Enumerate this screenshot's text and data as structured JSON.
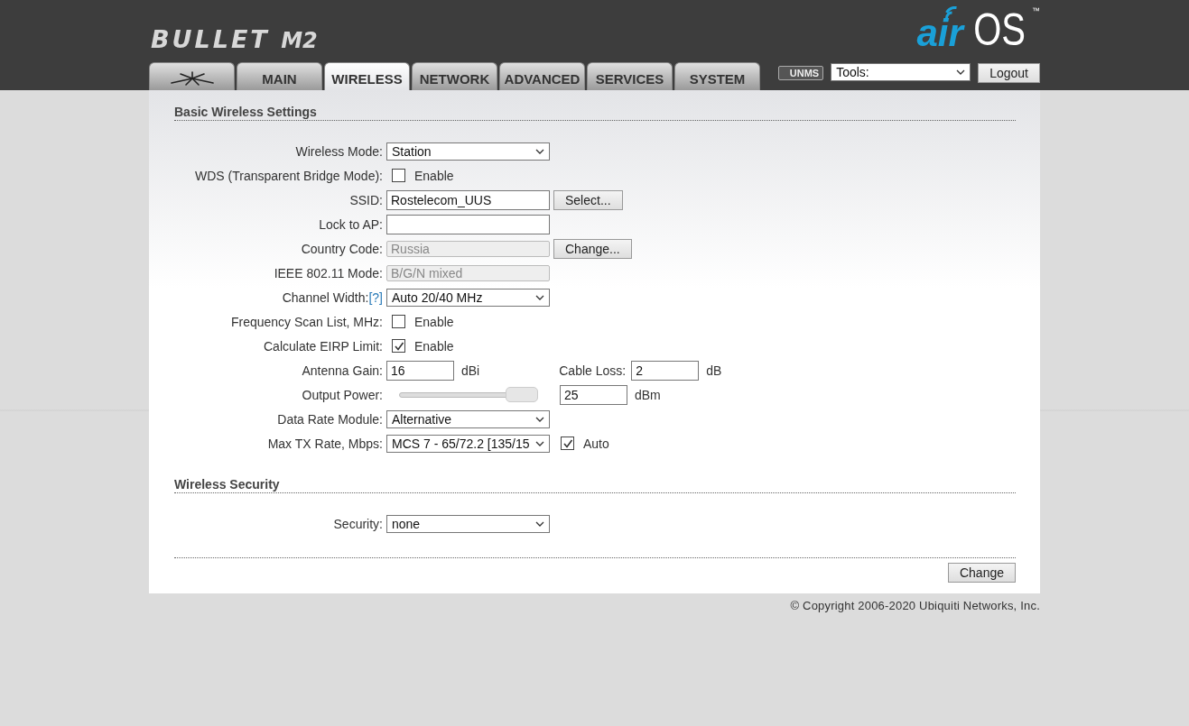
{
  "header": {
    "product": "BULLET",
    "model": "M2",
    "brand_left": "air",
    "brand_right": "OS",
    "trademark": "™"
  },
  "tabs": [
    {
      "kind": "icon",
      "selected": false
    },
    {
      "label": "MAIN",
      "selected": false
    },
    {
      "label": "WIRELESS",
      "selected": true
    },
    {
      "label": "NETWORK",
      "selected": false
    },
    {
      "label": "ADVANCED",
      "selected": false
    },
    {
      "label": "SERVICES",
      "selected": false
    },
    {
      "label": "SYSTEM",
      "selected": false
    }
  ],
  "toolbar": {
    "unms": "UNMS",
    "tools": "Tools:",
    "logout": "Logout"
  },
  "sections": [
    {
      "title": "Basic Wireless Settings",
      "rows": [
        {
          "kind": "select",
          "label": "Wireless Mode:",
          "value": "Station"
        },
        {
          "kind": "checkbox",
          "label": "WDS (Transparent Bridge Mode):",
          "checked": false,
          "option": "Enable"
        },
        {
          "kind": "input",
          "label": "SSID:",
          "value": "Rostelecom_UUS",
          "disabled": false,
          "button": "Select..."
        },
        {
          "kind": "input",
          "label": "Lock to AP:",
          "value": "",
          "disabled": false
        },
        {
          "kind": "input",
          "label": "Country Code:",
          "value": "Russia",
          "disabled": true,
          "button": "Change..."
        },
        {
          "kind": "input",
          "label": "IEEE 802.11 Mode:",
          "value": "B/G/N mixed",
          "disabled": true
        },
        {
          "kind": "select",
          "label": "Channel Width:",
          "help": "[?]",
          "value": "Auto 20/40 MHz"
        },
        {
          "kind": "checkbox",
          "label": "Frequency Scan List, MHz:",
          "checked": false,
          "option": "Enable"
        },
        {
          "kind": "checkbox",
          "label": "Calculate EIRP Limit:",
          "checked": true,
          "option": "Enable"
        },
        {
          "kind": "pair",
          "label": "Antenna Gain:",
          "value": "16",
          "unit": "dBi",
          "label2": "Cable Loss:",
          "value2": "2",
          "unit2": "dB"
        },
        {
          "kind": "slider",
          "label": "Output Power:",
          "level": 1,
          "value": "25",
          "unit": "dBm"
        },
        {
          "kind": "select",
          "label": "Data Rate Module:",
          "value": "Alternative"
        },
        {
          "kind": "select",
          "label": "Max TX Rate, Mbps:",
          "value": "MCS 7 - 65/72.2 [135/15",
          "check": {
            "checked": true,
            "option": "Auto"
          }
        }
      ]
    },
    {
      "title": "Wireless Security",
      "rows": [
        {
          "kind": "select",
          "label": "Security:",
          "value": "none"
        }
      ]
    }
  ],
  "submit": "Change",
  "footer": "© Copyright 2006-2020 Ubiquiti Networks, Inc."
}
